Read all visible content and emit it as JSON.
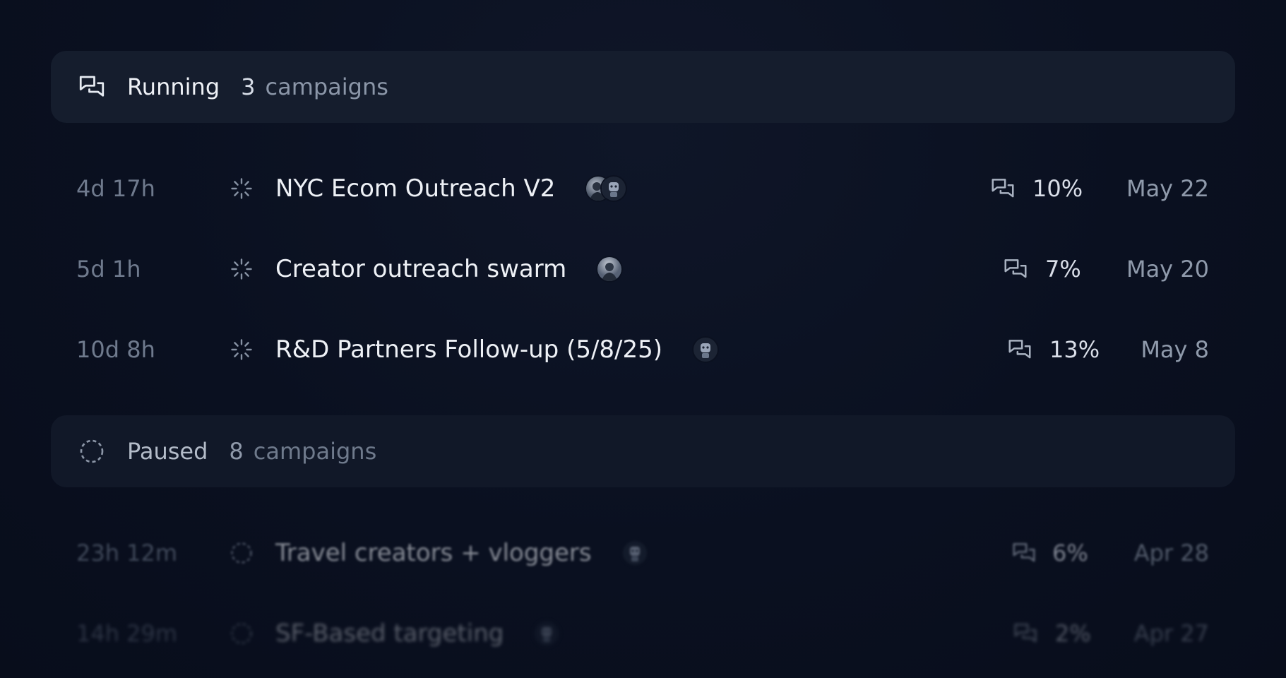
{
  "sections": {
    "running": {
      "icon": "chat-bubbles-icon",
      "title": "Running",
      "count": "3",
      "unit": "campaigns",
      "rows": [
        {
          "time": "4d 17h",
          "status_icon": "spinner-icon",
          "name": "NYC Ecom Outreach V2",
          "avatars": [
            "avatar-photo",
            "avatar-robot"
          ],
          "reply_icon": "chat-bubbles-icon",
          "rate": "10%",
          "date": "May 22"
        },
        {
          "time": "5d 1h",
          "status_icon": "spinner-icon",
          "name": "Creator outreach swarm",
          "avatars": [
            "avatar-photo"
          ],
          "reply_icon": "chat-bubbles-icon",
          "rate": "7%",
          "date": "May 20"
        },
        {
          "time": "10d 8h",
          "status_icon": "spinner-icon",
          "name": "R&D Partners Follow-up (5/8/25)",
          "avatars": [
            "avatar-robot"
          ],
          "reply_icon": "chat-bubbles-icon",
          "rate": "13%",
          "date": "May 8"
        }
      ]
    },
    "paused": {
      "icon": "dashed-circle-icon",
      "title": "Paused",
      "count": "8",
      "unit": "campaigns",
      "rows": [
        {
          "time": "23h 12m",
          "status_icon": "dashed-circle-icon",
          "name": "Travel creators + vloggers",
          "avatars": [
            "avatar-robot"
          ],
          "reply_icon": "chat-bubbles-icon",
          "rate": "6%",
          "date": "Apr 28"
        },
        {
          "time": "14h 29m",
          "status_icon": "dashed-circle-icon",
          "name": "SF-Based targeting",
          "avatars": [
            "avatar-robot"
          ],
          "reply_icon": "chat-bubbles-icon",
          "rate": "2%",
          "date": "Apr 27"
        }
      ]
    }
  }
}
